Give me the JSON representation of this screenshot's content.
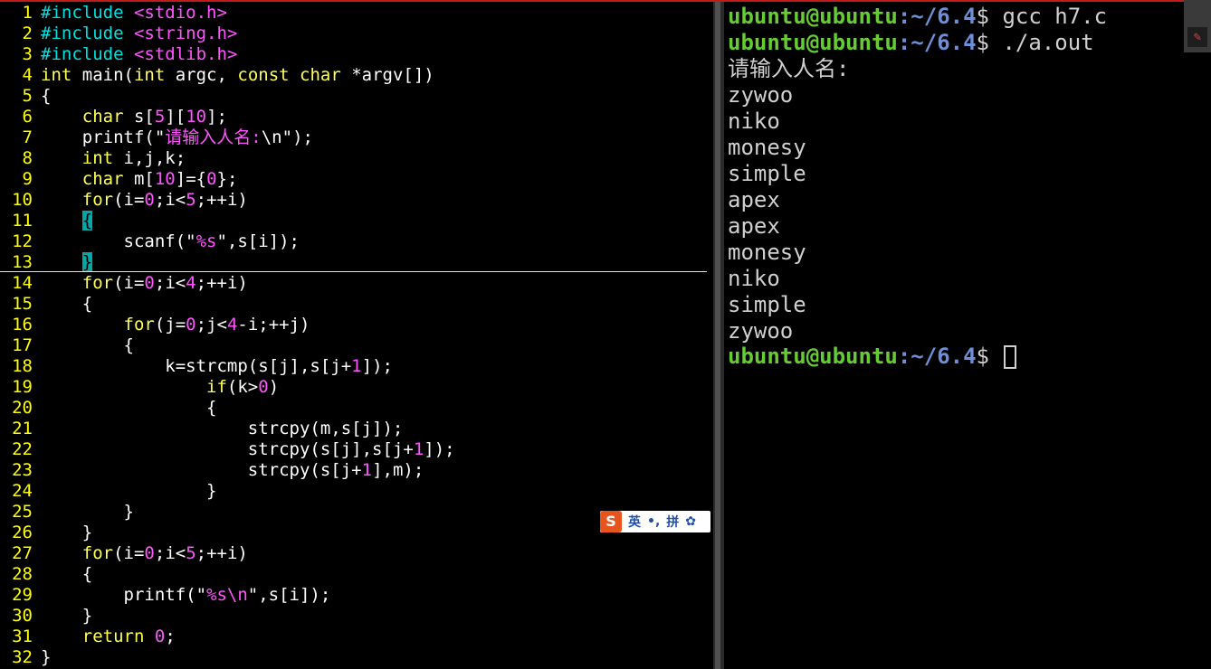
{
  "editor": {
    "lines": [
      {
        "n": "1",
        "parts": [
          [
            "#include ",
            "cy"
          ],
          [
            "<stdio.h>",
            "mg"
          ]
        ]
      },
      {
        "n": "2",
        "parts": [
          [
            "#include ",
            "cy"
          ],
          [
            "<string.h>",
            "mg"
          ]
        ]
      },
      {
        "n": "3",
        "parts": [
          [
            "#include ",
            "cy"
          ],
          [
            "<stdlib.h>",
            "mg"
          ]
        ]
      },
      {
        "n": "4",
        "parts": [
          [
            "int",
            "yl"
          ],
          [
            " main(",
            "wh"
          ],
          [
            "int",
            "yl"
          ],
          [
            " argc, ",
            "wh"
          ],
          [
            "const",
            "yl"
          ],
          [
            " ",
            "wh"
          ],
          [
            "char",
            "yl"
          ],
          [
            " *argv[])",
            "wh"
          ]
        ]
      },
      {
        "n": "5",
        "parts": [
          [
            "{",
            "wh"
          ]
        ]
      },
      {
        "n": "6",
        "parts": [
          [
            "    ",
            "wh"
          ],
          [
            "char",
            "yl"
          ],
          [
            " s[",
            "wh"
          ],
          [
            "5",
            "mg"
          ],
          [
            "][",
            "wh"
          ],
          [
            "10",
            "mg"
          ],
          [
            "];",
            "wh"
          ]
        ]
      },
      {
        "n": "7",
        "parts": [
          [
            "    printf(\"",
            "wh"
          ],
          [
            "请输入人名:",
            "mg"
          ],
          [
            "\\n",
            "wh"
          ],
          [
            "\");",
            "wh"
          ]
        ]
      },
      {
        "n": "8",
        "parts": [
          [
            "    ",
            "wh"
          ],
          [
            "int",
            "yl"
          ],
          [
            " i,j,k;",
            "wh"
          ]
        ]
      },
      {
        "n": "9",
        "parts": [
          [
            "    ",
            "wh"
          ],
          [
            "char",
            "yl"
          ],
          [
            " m[",
            "wh"
          ],
          [
            "10",
            "mg"
          ],
          [
            "]={",
            "wh"
          ],
          [
            "0",
            "mg"
          ],
          [
            "};",
            "wh"
          ]
        ]
      },
      {
        "n": "10",
        "parts": [
          [
            "    ",
            "wh"
          ],
          [
            "for",
            "yl"
          ],
          [
            "(i=",
            "wh"
          ],
          [
            "0",
            "mg"
          ],
          [
            ";i<",
            "wh"
          ],
          [
            "5",
            "mg"
          ],
          [
            ";++i)",
            "wh"
          ]
        ]
      },
      {
        "n": "11",
        "parts": [
          [
            "    ",
            "wh"
          ],
          [
            "{",
            "hl"
          ]
        ]
      },
      {
        "n": "12",
        "parts": [
          [
            "        scanf(\"",
            "wh"
          ],
          [
            "%s",
            "mg"
          ],
          [
            "\",s[i]);",
            "wh"
          ]
        ]
      },
      {
        "n": "13",
        "parts": [
          [
            "    ",
            "wh"
          ],
          [
            "}",
            "hl"
          ]
        ]
      },
      {
        "n": "14",
        "parts": [
          [
            "    ",
            "wh"
          ],
          [
            "for",
            "yl"
          ],
          [
            "(i=",
            "wh"
          ],
          [
            "0",
            "mg"
          ],
          [
            ";i<",
            "wh"
          ],
          [
            "4",
            "mg"
          ],
          [
            ";++i)",
            "wh"
          ]
        ]
      },
      {
        "n": "15",
        "parts": [
          [
            "    {",
            "wh"
          ]
        ]
      },
      {
        "n": "16",
        "parts": [
          [
            "        ",
            "wh"
          ],
          [
            "for",
            "yl"
          ],
          [
            "(j=",
            "wh"
          ],
          [
            "0",
            "mg"
          ],
          [
            ";j<",
            "wh"
          ],
          [
            "4",
            "mg"
          ],
          [
            "-i;++j)",
            "wh"
          ]
        ]
      },
      {
        "n": "17",
        "parts": [
          [
            "        {",
            "wh"
          ]
        ]
      },
      {
        "n": "18",
        "parts": [
          [
            "            k=strcmp(s[j],s[j+",
            "wh"
          ],
          [
            "1",
            "mg"
          ],
          [
            "]);",
            "wh"
          ]
        ]
      },
      {
        "n": "19",
        "parts": [
          [
            "                ",
            "wh"
          ],
          [
            "if",
            "yl"
          ],
          [
            "(k>",
            "wh"
          ],
          [
            "0",
            "mg"
          ],
          [
            ")",
            "wh"
          ]
        ]
      },
      {
        "n": "20",
        "parts": [
          [
            "                {",
            "wh"
          ]
        ]
      },
      {
        "n": "21",
        "parts": [
          [
            "                    strcpy(m,s[j]);",
            "wh"
          ]
        ]
      },
      {
        "n": "22",
        "parts": [
          [
            "                    strcpy(s[j],s[j+",
            "wh"
          ],
          [
            "1",
            "mg"
          ],
          [
            "]);",
            "wh"
          ]
        ]
      },
      {
        "n": "23",
        "parts": [
          [
            "                    strcpy(s[j+",
            "wh"
          ],
          [
            "1",
            "mg"
          ],
          [
            "],m);",
            "wh"
          ]
        ]
      },
      {
        "n": "24",
        "parts": [
          [
            "                }",
            "wh"
          ]
        ]
      },
      {
        "n": "25",
        "parts": [
          [
            "        }",
            "wh"
          ]
        ]
      },
      {
        "n": "26",
        "parts": [
          [
            "    }",
            "wh"
          ]
        ]
      },
      {
        "n": "27",
        "parts": [
          [
            "    ",
            "wh"
          ],
          [
            "for",
            "yl"
          ],
          [
            "(i=",
            "wh"
          ],
          [
            "0",
            "mg"
          ],
          [
            ";i<",
            "wh"
          ],
          [
            "5",
            "mg"
          ],
          [
            ";++i)",
            "wh"
          ]
        ]
      },
      {
        "n": "28",
        "parts": [
          [
            "    {",
            "wh"
          ]
        ]
      },
      {
        "n": "29",
        "parts": [
          [
            "        printf(\"",
            "wh"
          ],
          [
            "%s\\n",
            "mg"
          ],
          [
            "\",s[i]);",
            "wh"
          ]
        ]
      },
      {
        "n": "30",
        "parts": [
          [
            "    }",
            "wh"
          ]
        ]
      },
      {
        "n": "31",
        "parts": [
          [
            "    ",
            "wh"
          ],
          [
            "return",
            "yl"
          ],
          [
            " ",
            "wh"
          ],
          [
            "0",
            "mg"
          ],
          [
            ";",
            "wh"
          ]
        ]
      },
      {
        "n": "32",
        "parts": [
          [
            "}",
            "wh"
          ]
        ]
      }
    ]
  },
  "terminal": {
    "prompt_user": "ubuntu@ubuntu",
    "prompt_path": ":~/6.4",
    "prompt_symbol": "$",
    "commands": [
      " gcc h7.c",
      " ./a.out"
    ],
    "output": [
      "请输入人名:",
      "zywoo",
      "niko",
      "monesy",
      "simple",
      "apex",
      "apex",
      "monesy",
      "niko",
      "simple",
      "zywoo"
    ]
  },
  "ime": {
    "logo": "S",
    "items": [
      "英",
      "•,",
      "拼",
      "✿"
    ]
  }
}
